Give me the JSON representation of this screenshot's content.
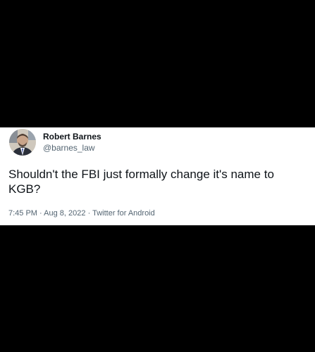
{
  "tweet": {
    "author": {
      "display_name": "Robert Barnes",
      "handle": "@barnes_law",
      "avatar_icon": "user-avatar"
    },
    "text": "Shouldn't the FBI just formally change it's name to KGB?",
    "meta": {
      "time": "7:45 PM",
      "separator": "·",
      "date": "Aug 8, 2022",
      "source": "Twitter for Android"
    }
  },
  "colors": {
    "background": "#000000",
    "card": "#ffffff",
    "primary_text": "#0f1419",
    "secondary_text": "#536471"
  }
}
